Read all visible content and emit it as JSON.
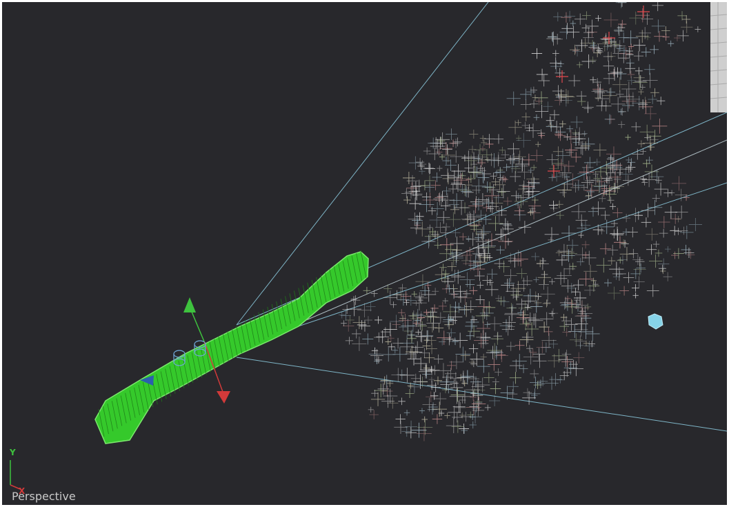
{
  "viewport": {
    "view_label": "Perspective",
    "background_color": "#28282c"
  },
  "axis_indicator": {
    "y_label": "Y",
    "x_label": "X",
    "y_color": "#3ec23e",
    "x_color": "#d23a3a"
  },
  "scene": {
    "objects": [
      {
        "name": "mesh-object",
        "description_color": "#3bd02f"
      },
      {
        "name": "point-cloud",
        "glyph": "+"
      },
      {
        "name": "locator-cube",
        "color": "#86d3e8"
      },
      {
        "name": "background-plane",
        "color": "#d8d8d8"
      }
    ],
    "gizmo": {
      "y_handle_color": "#3ec23e",
      "x_handle_color": "#d23a3a",
      "z_handle_color": "#2b5fae"
    },
    "camera_line_color": "#7fb6c8"
  }
}
